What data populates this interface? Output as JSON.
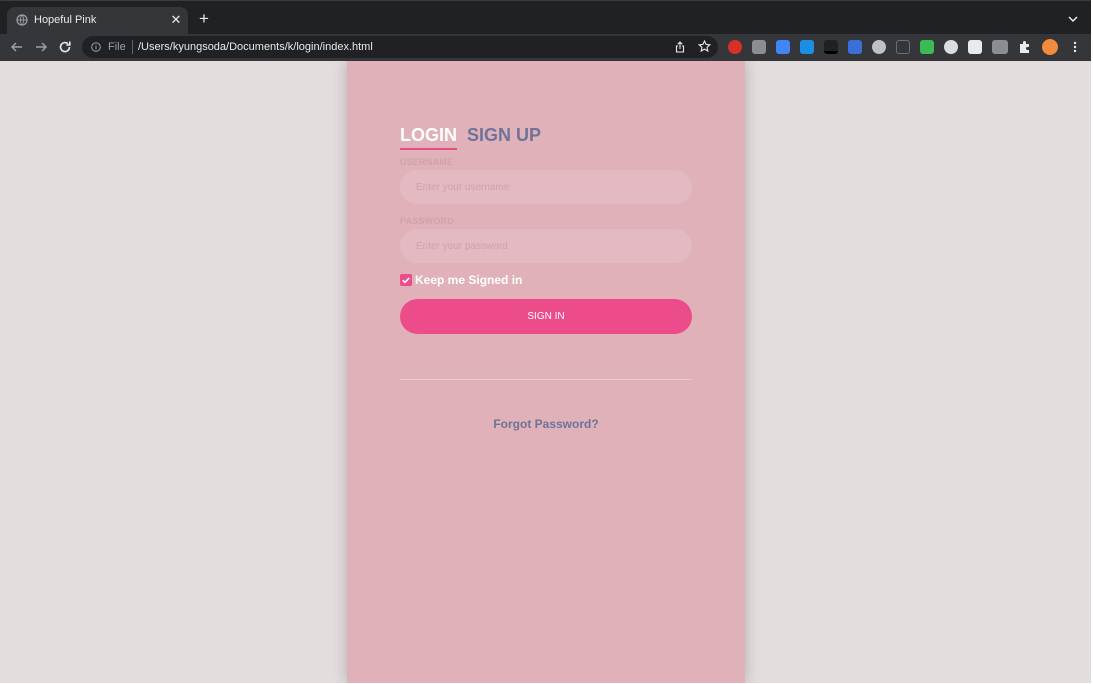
{
  "browser": {
    "tab_title": "Hopeful Pink",
    "tab_close": "✕",
    "new_tab": "+",
    "url_scheme": "File",
    "url_path": "/Users/kyungsoda/Documents/k/login/index.html"
  },
  "login": {
    "tab_login": "LOGIN",
    "tab_signup": "SIGN UP",
    "username_label": "USERNAME",
    "username_placeholder": "Enter your username",
    "password_label": "PASSWORD",
    "password_placeholder": "Enter your password",
    "keep_signed_in": "Keep me Signed in",
    "keep_signed_in_checked": true,
    "sign_in_button": "SIGN IN",
    "forgot_password": "Forgot Password?"
  },
  "colors": {
    "page_background": "#e3dddd",
    "card_background": "#e0b1b9",
    "accent_pink": "#ec4d8a",
    "muted_text": "#6f7399",
    "input_background": "#e3bac1"
  }
}
